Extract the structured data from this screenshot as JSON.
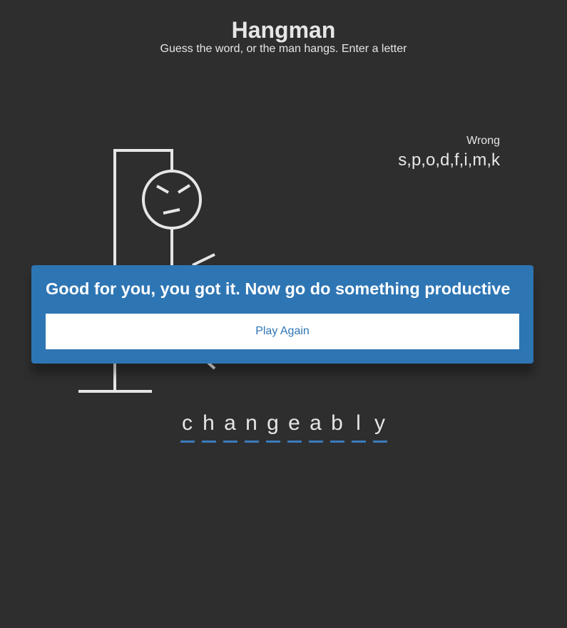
{
  "header": {
    "title": "Hangman",
    "subtitle": "Guess the word, or the man hangs. Enter a letter"
  },
  "wrong": {
    "label": "Wrong",
    "letters": "s,p,o,d,f,i,m,k"
  },
  "word": [
    "c",
    "h",
    "a",
    "n",
    "g",
    "e",
    "a",
    "b",
    "l",
    "y"
  ],
  "popup": {
    "message": "Good for you, you got it. Now go do something productive",
    "button_label": "Play Again"
  },
  "colors": {
    "background": "#2e2e2e",
    "text": "#e6e6e6",
    "accent": "#2e75b4",
    "underline": "#3a7bbd"
  }
}
